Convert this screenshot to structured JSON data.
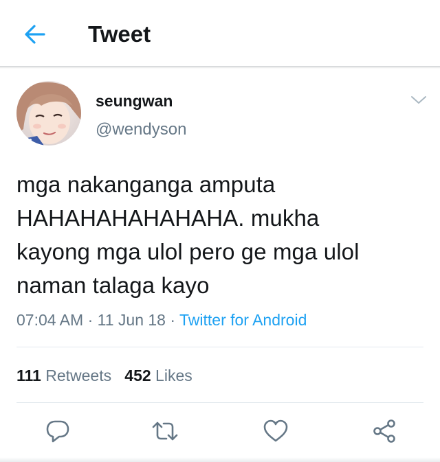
{
  "header": {
    "title": "Tweet",
    "back_icon": "arrow-left-icon"
  },
  "tweet": {
    "author": {
      "display_name": "seungwan",
      "handle": "@wendyson"
    },
    "text": "mga nakanganga amputa\nHAHAHAHAHAHAHA. mukha\nkayong mga ulol pero ge mga ulol\nnaman talaga kayo",
    "time": "07:04 AM",
    "date": "11 Jun 18",
    "source": "Twitter for Android",
    "separator": " · "
  },
  "stats": {
    "retweets_count": "111",
    "retweets_label": "Retweets",
    "likes_count": "452",
    "likes_label": "Likes"
  },
  "actions": {
    "reply_icon": "reply-icon",
    "retweet_icon": "retweet-icon",
    "like_icon": "heart-icon",
    "share_icon": "share-icon"
  },
  "colors": {
    "accent": "#1da1f2",
    "secondary_text": "#657786",
    "primary_text": "#14171a",
    "divider": "#e1e8ed"
  }
}
